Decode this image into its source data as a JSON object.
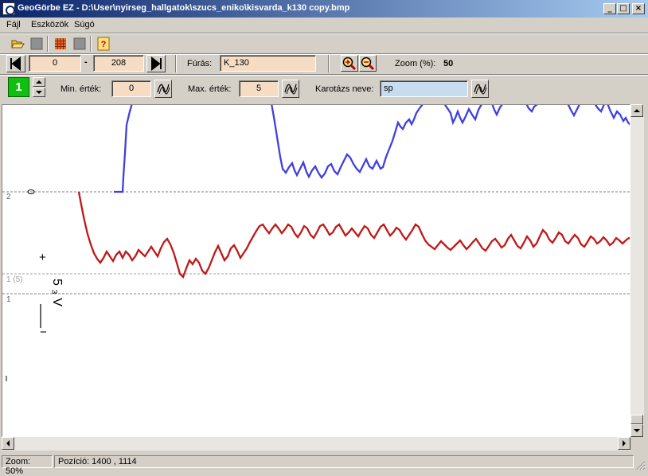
{
  "window": {
    "title": "GeoGörbe EZ - D:\\User\\nyirseg_hallgatok\\szucs_eniko\\kisvarda_k130 copy.bmp",
    "minimize_glyph": "_",
    "maximize_glyph": "□",
    "close_glyph": "×"
  },
  "menu": {
    "file": "Fájl",
    "tools": "Eszközök",
    "help": "Súgó"
  },
  "nav": {
    "from": "0",
    "dash": "-",
    "to": "208"
  },
  "drill": {
    "label": "Fúrás:",
    "value": "K_130"
  },
  "zoom": {
    "label": "Zoom (%):",
    "value": "50"
  },
  "log": {
    "index": "1",
    "min_label": "Min. érték:",
    "min_value": "0",
    "max_label": "Max. érték:",
    "max_value": "5",
    "name_label": "Karotázs neve:",
    "name_value": "sp"
  },
  "canvas": {
    "line_labels": [
      "2",
      "1 (5)",
      "1"
    ],
    "annot_plus": "+",
    "annot_scale": "5 ₃ V",
    "annot_minus": "−",
    "curve_colors": {
      "blue": "#4040e0",
      "red": "#c01818"
    }
  },
  "status": {
    "zoom": "Zoom: 50%",
    "position": "Pozíció: 1400 , 1114"
  },
  "icons": [
    "open-folder-icon",
    "save-icon",
    "grid-icon",
    "stop-icon",
    "help-icon",
    "zoom-in-icon",
    "zoom-out-icon",
    "curve-icon"
  ]
}
